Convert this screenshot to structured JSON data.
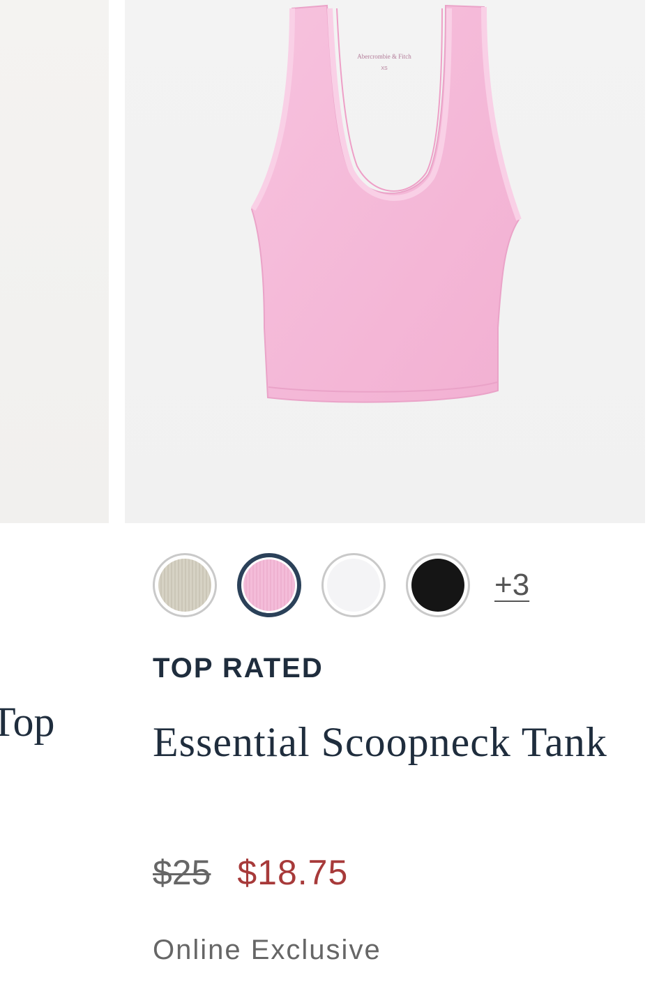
{
  "previous_card": {
    "title_fragment": "Top"
  },
  "product": {
    "image_label_brand": "Abercrombie & Fitch",
    "image_label_size": "XS",
    "swatches": [
      {
        "name": "beige-ribbed",
        "color": "#d6d2c4"
      },
      {
        "name": "pink",
        "color": "#f2b8d6",
        "selected": true
      },
      {
        "name": "white",
        "color": "#f4f4f6"
      },
      {
        "name": "black",
        "color": "#151515"
      }
    ],
    "more_colors": "+3",
    "badge": "TOP RATED",
    "title": "Essential Scoopneck Tank",
    "price_original": "$25",
    "price_sale": "$18.75",
    "availability": "Online Exclusive"
  },
  "colors": {
    "navy_text": "#1f2d3d",
    "sale_red": "#a73a3a",
    "selected_ring": "#2b4159",
    "tank_pink": "#f5b9d8"
  }
}
